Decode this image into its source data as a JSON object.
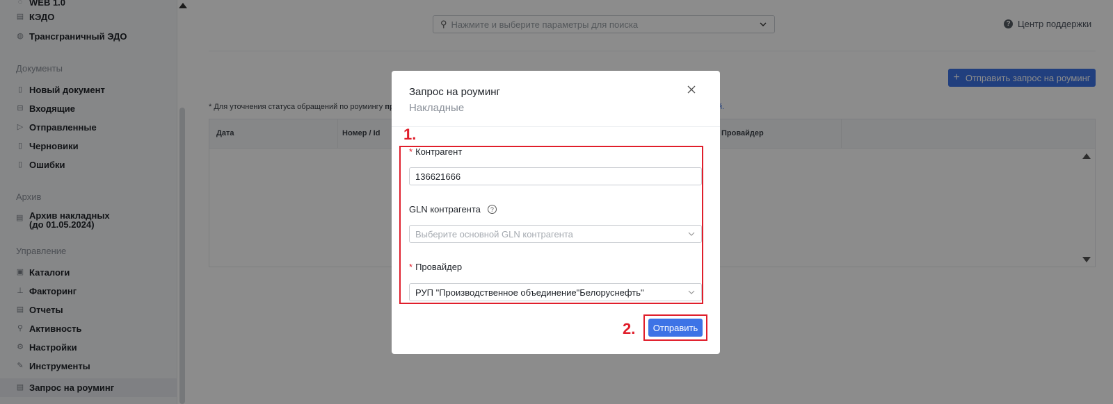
{
  "sidebar": {
    "top_items": [
      {
        "label": "WEB 1.0",
        "icon": "globe-icon"
      },
      {
        "label": "КЭДО",
        "icon": "document-icon"
      },
      {
        "label": "Трансграничный ЭДО",
        "icon": "globe-icon"
      }
    ],
    "sections": {
      "documents": "Документы",
      "archive": "Архив",
      "management": "Управление"
    },
    "documents": [
      {
        "label": "Новый документ",
        "icon": "new-document-icon"
      },
      {
        "label": "Входящие",
        "icon": "inbox-icon"
      },
      {
        "label": "Отправленные",
        "icon": "send-icon"
      },
      {
        "label": "Черновики",
        "icon": "draft-icon"
      },
      {
        "label": "Ошибки",
        "icon": "error-document-icon"
      }
    ],
    "archive": {
      "line1": "Архив накладных",
      "line2": "(до 01.05.2024)"
    },
    "management": [
      {
        "label": "Каталоги",
        "icon": "catalog-icon"
      },
      {
        "label": "Факторинг",
        "icon": "chart-icon"
      },
      {
        "label": "Отчеты",
        "icon": "report-icon"
      },
      {
        "label": "Активность",
        "icon": "search-icon"
      },
      {
        "label": "Настройки",
        "icon": "gear-icon"
      },
      {
        "label": "Инструменты",
        "icon": "wrench-icon"
      },
      {
        "label": "Запрос на роуминг",
        "icon": "roaming-icon"
      }
    ]
  },
  "header": {
    "search_placeholder": "Нажмите и выберите параметры для поиска",
    "support": "Центр поддержки"
  },
  "main": {
    "roaming_button": "Отправить запрос на роуминг",
    "note_prefix": "* Для уточнения статуса обращений по роумингу",
    "note_bold": "про",
    "note_link_tail": "й.",
    "columns": [
      "Дата",
      "Номер / Id",
      "Провайдер"
    ]
  },
  "modal": {
    "title": "Запрос на роуминг",
    "subtitle": "Накладные",
    "step1": "1.",
    "step2": "2.",
    "counterparty_label": "Контрагент",
    "counterparty_value": "136621666",
    "gln_label": "GLN контрагента",
    "gln_placeholder": "Выберите основной GLN контрагента",
    "provider_label": "Провайдер",
    "provider_value": "РУП \"Производственное объединение\"Белоруснефть\"",
    "submit": "Отправить",
    "required_mark": "*"
  },
  "colors": {
    "accent": "#3d73e6",
    "annotation_red": "#e01e2b",
    "overlay": "rgba(0,0,0,0.45)"
  }
}
